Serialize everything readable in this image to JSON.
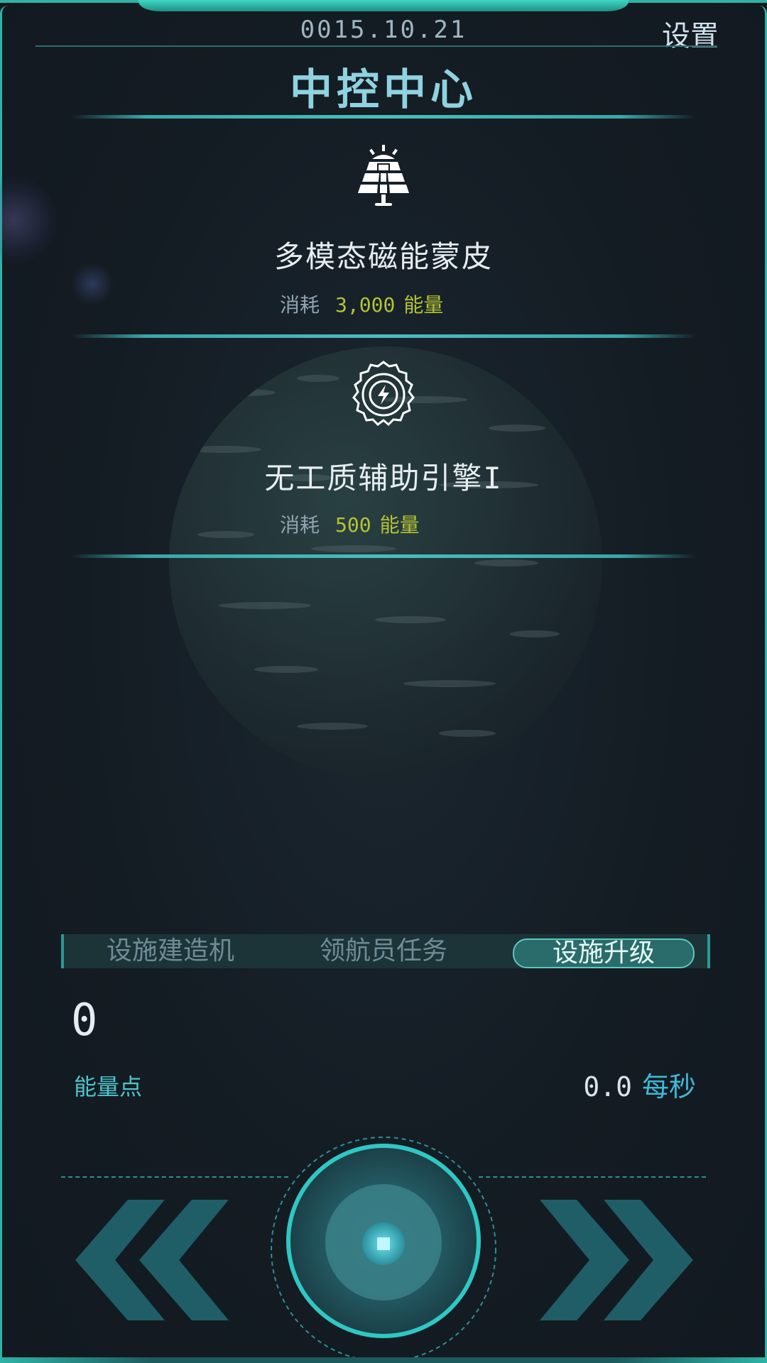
{
  "header": {
    "date": "0015.10.21",
    "settings_label": "设置",
    "title": "中控中心"
  },
  "upgrades": [
    {
      "icon": "solar-panel-icon",
      "name": "多模态磁能蒙皮",
      "cost_label": "消耗",
      "cost_value": "3,000",
      "cost_unit": "能量"
    },
    {
      "icon": "gear-lightning-icon",
      "name": "无工质辅助引擎I",
      "cost_label": "消耗",
      "cost_value": "500",
      "cost_unit": "能量"
    }
  ],
  "tabs": [
    {
      "label": "设施建造机",
      "active": false
    },
    {
      "label": "领航员任务",
      "active": false
    },
    {
      "label": "设施升级",
      "active": true
    }
  ],
  "stats": {
    "energy_points": "0",
    "energy_label": "能量点",
    "rate_value": "0.0",
    "rate_unit": "每秒"
  },
  "controls": {
    "left_icon": "double-chevron-left-icon",
    "center_icon": "stop-icon",
    "right_icon": "double-chevron-right-icon"
  },
  "colors": {
    "accent": "#2fb3a6",
    "cost_value": "#b5c234",
    "rate_unit": "#3fb8d6",
    "background": "#151d24"
  }
}
